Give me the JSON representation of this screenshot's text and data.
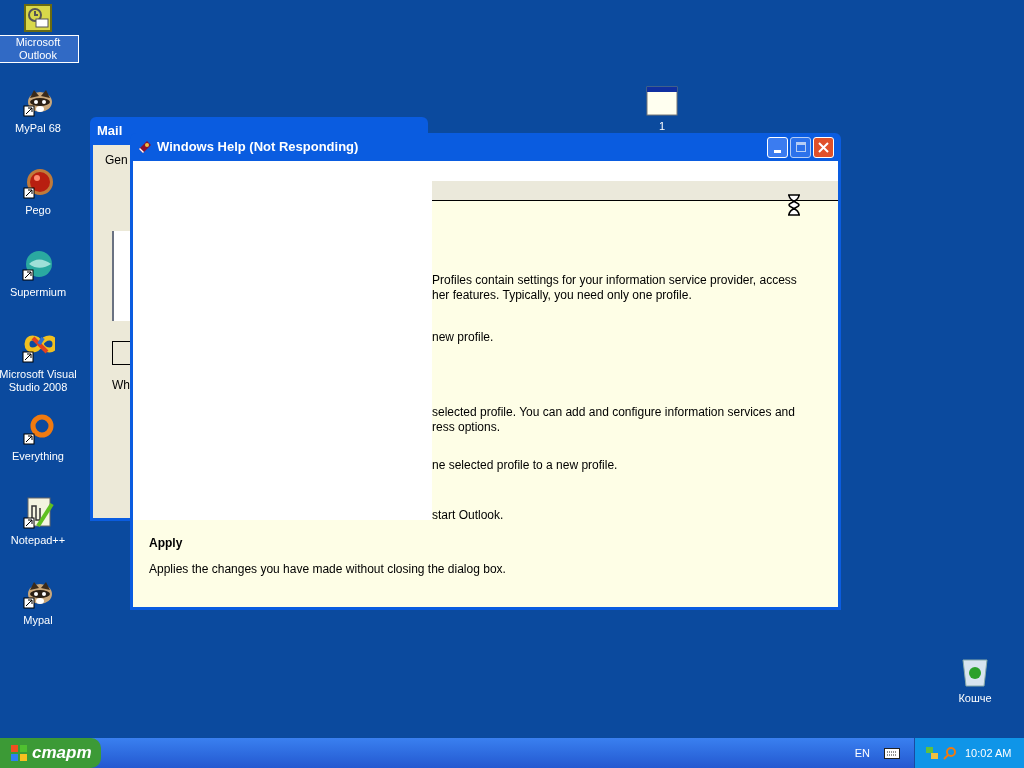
{
  "desktop_icons": [
    {
      "label": "Microsoft Outlook",
      "selected": true,
      "kind": "outlook"
    },
    {
      "label": "MyPal 68",
      "selected": false,
      "kind": "raccoon"
    },
    {
      "label": "Pego",
      "selected": false,
      "kind": "ball"
    },
    {
      "label": "Supermium",
      "selected": false,
      "kind": "browser"
    },
    {
      "label": "Microsoft Visual Studio 2008",
      "selected": false,
      "kind": "infinity"
    },
    {
      "label": "Everything",
      "selected": false,
      "kind": "ring"
    },
    {
      "label": "Notepad++",
      "selected": false,
      "kind": "notepad"
    },
    {
      "label": "Mypal",
      "selected": false,
      "kind": "raccoon"
    }
  ],
  "window_icon": {
    "label": "1",
    "selected": false
  },
  "recycle_bin": {
    "label": "Кошче",
    "selected": false
  },
  "mail_window": {
    "title": "Mail",
    "tab": "Gen",
    "label": "Wh"
  },
  "help_window": {
    "title": "Windows Help (Not Responding)",
    "paragraphs": [
      {
        "lines": [
          "Profiles contain settings for your information service provider, access",
          "her features. Typically, you need only one profile."
        ]
      },
      {
        "lines": [
          "new profile."
        ]
      },
      {
        "lines": [
          "selected profile. You can add and configure information services and",
          "ress options."
        ]
      },
      {
        "lines": [
          "ne selected profile to a new profile."
        ]
      },
      {
        "lines": [
          "start Outlook."
        ]
      }
    ],
    "apply_heading": "Apply",
    "apply_text": "Applies the changes you have made without closing the dialog box."
  },
  "taskbar": {
    "start": "старт",
    "language": "EN",
    "clock": "10:02 AM"
  }
}
